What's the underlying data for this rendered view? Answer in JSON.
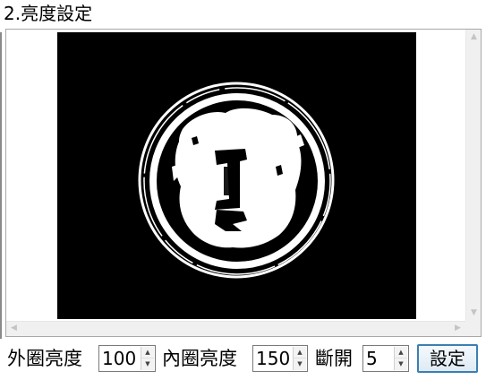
{
  "section": {
    "title": "2.亮度設定"
  },
  "controls": {
    "outer_label": "外圈亮度",
    "outer_value": "100",
    "inner_label": "內圈亮度",
    "inner_value": "150",
    "break_label": "斷開",
    "break_value": "5",
    "set_button": "設定"
  },
  "icons": {
    "scroll_up": "chevron-up-icon",
    "scroll_down": "chevron-down-icon",
    "scroll_left": "chevron-left-icon",
    "scroll_right": "chevron-right-icon",
    "spin_up": "spin-up-icon",
    "spin_down": "spin-down-icon"
  },
  "colors": {
    "preview_background": "#000000",
    "preview_foreground": "#ffffff",
    "button_border": "#3c7fb1"
  }
}
